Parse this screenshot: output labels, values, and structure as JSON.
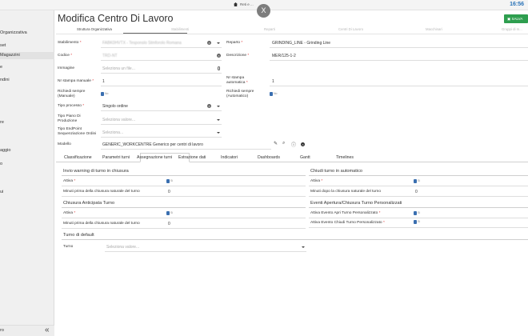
{
  "topbar": {
    "breadcrumb": "Reti e ...",
    "time": "16:56"
  },
  "close_label": "X",
  "sidebar": {
    "items": [
      "Organizzativa",
      "set",
      "Magazzini",
      "e",
      "ndini",
      "re",
      "aggio",
      "o",
      "ui"
    ],
    "bottom_label": "ro",
    "collapse_icon": "«"
  },
  "page_title": "Modifica Centro Di Lavoro",
  "save_label": "SALVA",
  "wizard_tabs": [
    "Struttura Organizzativa",
    "Stabilimenti",
    "Reparti",
    "Centri Di Lavoro",
    "Macchinari",
    "Gruppi di m..."
  ],
  "form": {
    "stabilimento": {
      "label": "Stabilimento",
      "value": "FABK0HVTX - Tesponslo Stmforolo Romana"
    },
    "reparto": {
      "label": "Reparto",
      "value": "GRINDING_LINE - Grinding Line"
    },
    "codice": {
      "label": "Codice",
      "value": "TRD-NT"
    },
    "descrizione": {
      "label": "Descrizione",
      "value": "MER/125-1-2"
    },
    "immagine": {
      "label": "Immagine",
      "placeholder": "Seleziona un file..."
    },
    "nr_stampa_manuale": {
      "label": "Nr stampa manuale",
      "value": "1"
    },
    "nr_stampa_automatica": {
      "label": "Nr stampa automatica",
      "value": "1"
    },
    "richiedi_manuale": {
      "label": "Richiedi sempre (Manuale)",
      "toggle": "No"
    },
    "richiedi_automatico": {
      "label": "Richiedi sempre (Automatico)",
      "toggle": "No"
    },
    "tipo_processo": {
      "label": "Tipo processo",
      "value": "Singolo ordine"
    },
    "tipo_piano": {
      "label": "Tipo Piano Di Produzione",
      "placeholder": "Seleziona valore..."
    },
    "tipo_endpoint": {
      "label": "Tipo EndPoint Sequenziazione Ordini",
      "placeholder": "Seleziona..."
    },
    "modello": {
      "label": "Modello",
      "value": "GENERIC_WORKCENTRE  Generico per centri di lavoro"
    }
  },
  "inner_tabs": [
    "Classificazione",
    "Parametri turni",
    "Assegnazione turni",
    "Estrazione dati",
    "Indicatori",
    "Dashboards",
    "Gantt",
    "Timelines"
  ],
  "shifts": {
    "invio_warning": {
      "title": "Invio warning di turno in chiusura",
      "attiva_label": "Attiva",
      "attiva_toggle": "Sì",
      "minuti_label": "Minuti prima della chiusura naturale del turno",
      "minuti_value": "0"
    },
    "chiudi_auto": {
      "title": "Chiudi turno in automatico",
      "attiva_label": "Attiva",
      "attiva_toggle": "Sì",
      "minuti_label": "Minuti dopo la chiusura naturale del turno",
      "minuti_value": "0"
    },
    "chiusura_anticipata": {
      "title": "Chiusura Anticipata Turno",
      "attiva_label": "Attiva",
      "attiva_toggle": "Sì",
      "minuti_label": "Minuti prima della chiusura naturale del turno",
      "minuti_value": "0"
    },
    "eventi": {
      "title": "Eventi Apertura/Chiusura Turno Personalizzati",
      "apri_label": "Attiva Evento Apri Turno Personalizzato",
      "apri_toggle": "Sì",
      "chiudi_label": "Attiva Evento Chiudi Turno Personalizzato",
      "chiudi_toggle": "Sì"
    },
    "default": {
      "title": "Turno di default",
      "turno_label": "Turno",
      "turno_placeholder": "Seleziona valore..."
    }
  },
  "colors": {
    "accent": "#3a6fb0",
    "save": "#2e9e4f",
    "time": "#2a73b8"
  }
}
